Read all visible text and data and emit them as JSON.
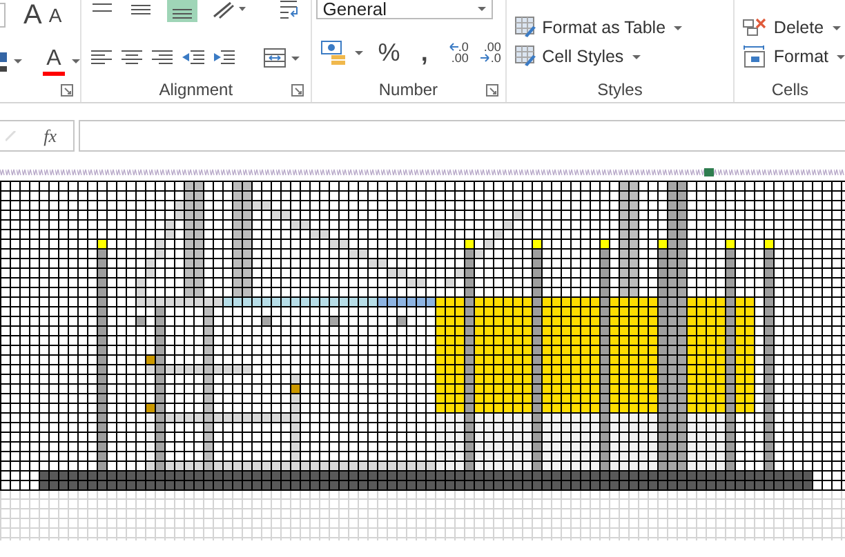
{
  "ribbon": {
    "font_group": {
      "size_buttons": [
        {
          "label": "A"
        },
        {
          "label": "A"
        }
      ],
      "font_color": {
        "label": "A",
        "color": "#ff0000"
      }
    },
    "alignment_group": {
      "label": "Alignment"
    },
    "number_group": {
      "format": "General",
      "percent": "%",
      "comma": ",",
      "decimal_buttons": [
        {
          "kind": "increase",
          "top": ".0",
          "bottom": ".00"
        },
        {
          "kind": "decrease",
          "top": ".00",
          "bottom": ".0"
        }
      ],
      "label": "Number"
    },
    "styles_group": {
      "items": [
        {
          "label": "Format as Table"
        },
        {
          "label": "Cell Styles"
        }
      ],
      "label": "Styles"
    },
    "cells_group": {
      "items": [
        {
          "kind": "delete",
          "label": "Delete"
        },
        {
          "kind": "format",
          "label": "Format"
        }
      ],
      "label": "Cells"
    }
  },
  "formula_bar": {
    "fx": "fx"
  }
}
